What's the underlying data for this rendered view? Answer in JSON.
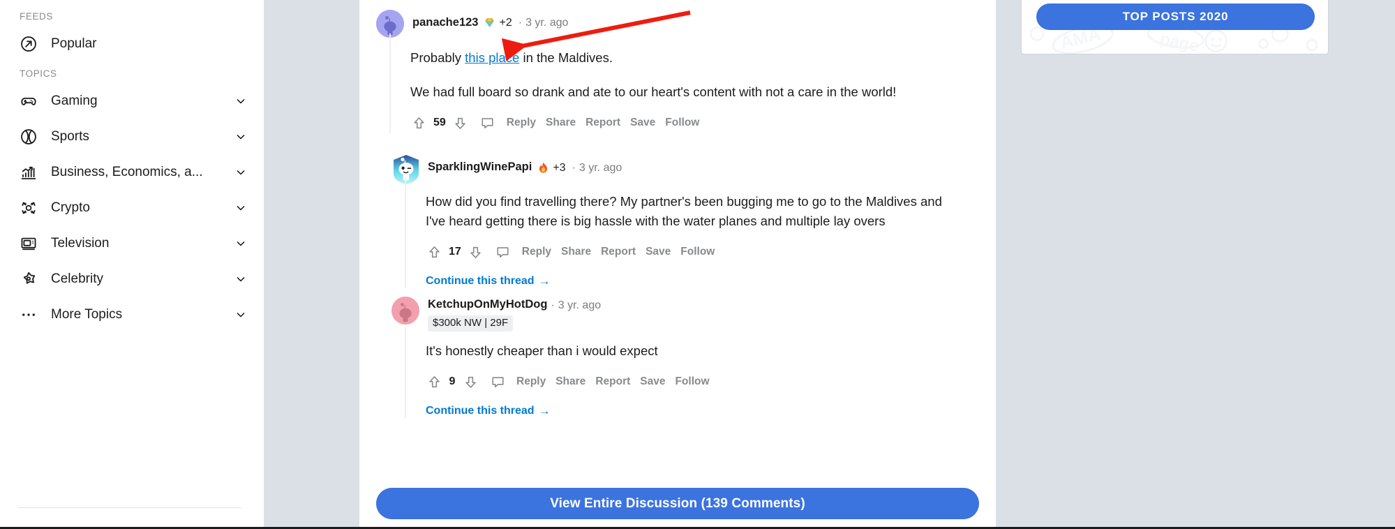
{
  "colors": {
    "page_bg": "#dae0e6",
    "card_bg": "#ffffff",
    "accent_blue": "#0079d3",
    "button_blue": "#3b73df",
    "muted_text": "#878a8c",
    "body_text": "#1c1c1c",
    "annotation_red": "#ee1c10"
  },
  "sidebar": {
    "feeds_label": "FEEDS",
    "topics_label": "TOPICS",
    "feeds": [
      {
        "label": "Popular",
        "icon": "popular-arrow-icon",
        "has_chevron": false
      }
    ],
    "topics": [
      {
        "label": "Gaming",
        "icon": "gamepad-icon",
        "has_chevron": true
      },
      {
        "label": "Sports",
        "icon": "baseball-icon",
        "has_chevron": true
      },
      {
        "label": "Business, Economics, a...",
        "icon": "bar-chart-icon",
        "has_chevron": true
      },
      {
        "label": "Crypto",
        "icon": "crypto-icon",
        "has_chevron": true
      },
      {
        "label": "Television",
        "icon": "television-icon",
        "has_chevron": true
      },
      {
        "label": "Celebrity",
        "icon": "star-icon",
        "has_chevron": true
      },
      {
        "label": "More Topics",
        "icon": "ellipsis-icon",
        "has_chevron": true
      }
    ]
  },
  "comments": [
    {
      "id": "c1",
      "author": "panache123",
      "avatar_color": "#a5a4f0",
      "avatar_style": "circle",
      "award_icon": "gem-award-icon",
      "award_count": "+2",
      "separator": "·",
      "timestamp": "3 yr. ago",
      "flair": null,
      "paragraphs": [
        {
          "before": "Probably ",
          "link": "this place",
          "after": " in the Maldives."
        },
        {
          "before": "We had full board so drank and ate to our heart's content with not a care in the world!",
          "link": null,
          "after": ""
        }
      ],
      "votes": "59",
      "actions": [
        "Reply",
        "Share",
        "Report",
        "Save",
        "Follow"
      ],
      "continue_label": null
    },
    {
      "id": "c2",
      "author": "SparklingWinePapi",
      "avatar_color": "#ffffff",
      "avatar_style": "nft",
      "award_icon": "flame-award-icon",
      "award_count": "+3",
      "separator": "·",
      "timestamp": "3 yr. ago",
      "flair": null,
      "paragraphs": [
        {
          "before": "How did you find travelling there? My partner's been bugging me to go to the Maldives and I've heard getting there is big hassle with the water planes and multiple lay overs",
          "link": null,
          "after": ""
        }
      ],
      "votes": "17",
      "actions": [
        "Reply",
        "Share",
        "Report",
        "Save",
        "Follow"
      ],
      "continue_label": "Continue this thread"
    },
    {
      "id": "c3",
      "author": "KetchupOnMyHotDog",
      "avatar_color": "#f2a0ae",
      "avatar_style": "circle",
      "award_icon": null,
      "award_count": null,
      "separator": "·",
      "timestamp": "3 yr. ago",
      "flair": "$300k NW | 29F",
      "paragraphs": [
        {
          "before": "It's honestly cheaper than i would expect",
          "link": null,
          "after": ""
        }
      ],
      "votes": "9",
      "actions": [
        "Reply",
        "Share",
        "Report",
        "Save",
        "Follow"
      ],
      "continue_label": "Continue this thread"
    }
  ],
  "view_all": {
    "label": "View Entire Discussion (139 Comments)"
  },
  "right_panel": {
    "top_posts_label": "TOP POSTS 2020"
  },
  "annotation": {
    "type": "red-arrow",
    "points_to": "this place"
  }
}
